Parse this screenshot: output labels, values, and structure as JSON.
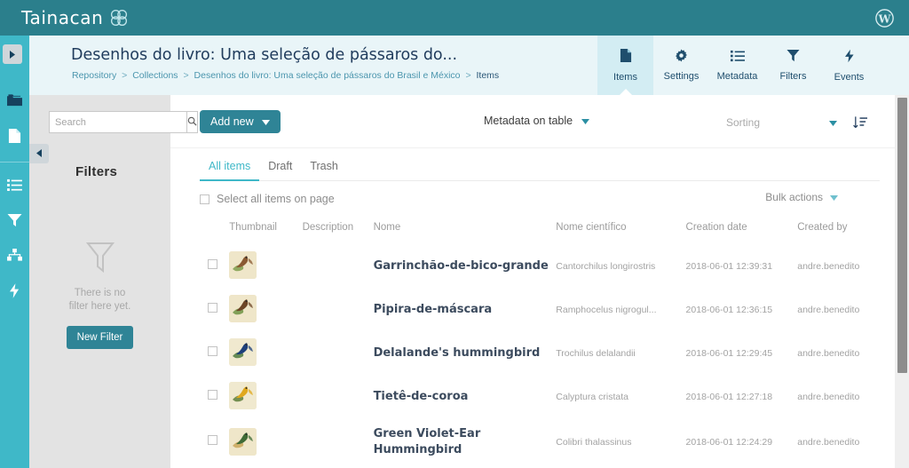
{
  "adminbar": {
    "brand_text": "Tainacan",
    "brand_mark_icon": "tainacan-logo-icon",
    "wp_icon": "wordpress-logo-icon"
  },
  "rail": {
    "toggle_icon": "chevron-right-icon",
    "items": [
      {
        "icon": "collections-folder-icon",
        "name": "rail-item-collections",
        "active": true
      },
      {
        "icon": "items-file-icon",
        "name": "rail-item-items",
        "active": false
      },
      {
        "icon": "metadata-list-icon",
        "name": "rail-item-metadata",
        "active": false
      },
      {
        "icon": "filters-funnel-icon",
        "name": "rail-item-filters",
        "active": false
      },
      {
        "icon": "taxonomies-icon",
        "name": "rail-item-taxonomies",
        "active": false
      },
      {
        "icon": "events-bolt-icon",
        "name": "rail-item-events",
        "active": false
      }
    ]
  },
  "collection_header": {
    "title": "Desenhos do livro: Uma seleção de pássaros do...",
    "breadcrumb": [
      "Repository",
      "Collections",
      "Desenhos do livro: Uma seleção de pássaros do Brasil e México",
      "Items"
    ],
    "breadcrumb_separator": ">",
    "tabs": [
      {
        "label": "Items",
        "icon": "file-icon",
        "active": true
      },
      {
        "label": "Settings",
        "icon": "gear-icon",
        "active": false
      },
      {
        "label": "Metadata",
        "icon": "list-icon",
        "active": false
      },
      {
        "label": "Filters",
        "icon": "funnel-icon",
        "active": false
      },
      {
        "label": "Events",
        "icon": "bolt-icon",
        "active": false
      }
    ]
  },
  "filters_panel": {
    "search_placeholder": "Search",
    "search_value": "",
    "search_icon": "search-icon",
    "collapse_icon": "chevron-left-icon",
    "title": "Filters",
    "empty_icon": "funnel-outline-icon",
    "empty_line1": "There is no",
    "empty_line2": "filter here yet.",
    "new_filter_label": "New Filter"
  },
  "toolbar": {
    "add_new_label": "Add new",
    "add_new_caret_icon": "caret-down-icon",
    "metadata_on_table_label": "Metadata on table",
    "metadata_caret_icon": "caret-down-icon",
    "sorting_label": "Sorting",
    "sorting_caret_icon": "caret-down-icon",
    "sort_order_icon": "sort-descending-icon"
  },
  "subtabs": [
    {
      "label": "All items",
      "active": true
    },
    {
      "label": "Draft",
      "active": false
    },
    {
      "label": "Trash",
      "active": false
    }
  ],
  "select_all": {
    "label": "Select all items on page",
    "checked": false
  },
  "bulk_actions": {
    "label": "Bulk actions",
    "caret_icon": "caret-down-icon"
  },
  "table": {
    "headers": [
      "",
      "Thumbnail",
      "Description",
      "Nome",
      "Nome científico",
      "Creation date",
      "Created by"
    ],
    "rows": [
      {
        "checked": false,
        "thumbnail_icon": "bird-thumbnail-icon",
        "thumb_colors": {
          "bg": "#efe6c9",
          "bird": "#8a5a32",
          "leaf": "#7f9e4e"
        },
        "description": "",
        "nome": "Garrinchão-de-bico-grande",
        "nome_cientifico": "Cantorchilus longirostris",
        "creation_date": "2018-06-01 12:39:31",
        "created_by": "andre.benedito"
      },
      {
        "checked": false,
        "thumbnail_icon": "bird-thumbnail-icon",
        "thumb_colors": {
          "bg": "#efe6c9",
          "bird": "#6d4526",
          "leaf": "#6e9344"
        },
        "description": "",
        "nome": "Pipira-de-máscara",
        "nome_cientifico": "Ramphocelus nigrogul...",
        "creation_date": "2018-06-01 12:36:15",
        "created_by": "andre.benedito"
      },
      {
        "checked": false,
        "thumbnail_icon": "bird-thumbnail-icon",
        "thumb_colors": {
          "bg": "#f0e9cf",
          "bird": "#1d3f7a",
          "leaf": "#4f7a3f"
        },
        "description": "",
        "nome": "Delalande's hummingbird",
        "nome_cientifico": "Trochilus delalandii",
        "creation_date": "2018-06-01 12:29:45",
        "created_by": "andre.benedito"
      },
      {
        "checked": false,
        "thumbnail_icon": "bird-thumbnail-icon",
        "thumb_colors": {
          "bg": "#f0e9cf",
          "bird": "#e0a81e",
          "leaf": "#5e7f3b"
        },
        "description": "",
        "nome": "Tietê-de-coroa",
        "nome_cientifico": "Calyptura cristata",
        "creation_date": "2018-06-01 12:27:18",
        "created_by": "andre.benedito"
      },
      {
        "checked": false,
        "thumbnail_icon": "bird-thumbnail-icon",
        "thumb_colors": {
          "bg": "#efe6c9",
          "bird": "#3f6b36",
          "leaf": "#c9a65a"
        },
        "description": "",
        "nome": "Green Violet-Ear Hummingbird",
        "nome_cientifico": "Colibri thalassinus",
        "creation_date": "2018-06-01 12:24:29",
        "created_by": "andre.benedito"
      }
    ]
  },
  "colors": {
    "adminbar": "#2b7f8c",
    "rail": "#3fb8c8",
    "header_bg": "#e9f5f8",
    "tab_active_bg": "#d3edf3",
    "accent": "#2f8496",
    "accent_light": "#3fb8c8",
    "panel_bg": "#e3e3e3",
    "title_text": "#1f3b5c"
  }
}
